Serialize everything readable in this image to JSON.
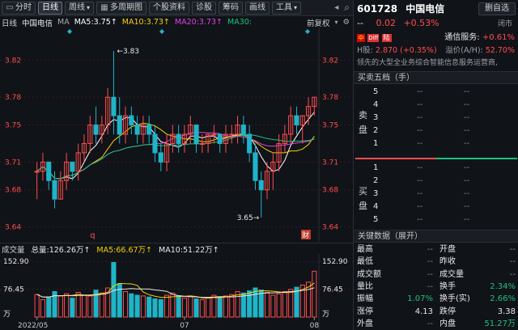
{
  "toolbar": {
    "items": [
      {
        "label": "分时",
        "icon": "timeshare-icon",
        "active": false
      },
      {
        "label": "日线",
        "icon": "",
        "active": true
      },
      {
        "label": "周线",
        "icon": "chevron-down-icon",
        "active": false
      },
      {
        "label": "多周期图",
        "icon": "grid-icon",
        "active": false
      },
      {
        "label": "个股资料",
        "icon": "",
        "active": false
      },
      {
        "label": "诊股",
        "icon": "",
        "active": false
      },
      {
        "label": "筹码",
        "icon": "",
        "active": false
      },
      {
        "label": "画线",
        "icon": "",
        "active": false
      },
      {
        "label": "工具",
        "icon": "chevron-down-icon",
        "active": false
      }
    ],
    "more_glyph": "◂",
    "search_glyph": "⌕"
  },
  "ma_bar": {
    "period": "日线",
    "name": "中国电信",
    "ma_label": "MA",
    "ma5": "MA5:3.75↑",
    "ma10": "MA10:3.73↑",
    "ma20": "MA20:3.73↑",
    "ma30": "MA30:",
    "adjust": "前复权",
    "colors": {
      "ma5": "#ffffff",
      "ma10": "#f5d100",
      "ma20": "#e040e0",
      "ma30": "#19c37d"
    }
  },
  "chart_data": {
    "type": "candlestick",
    "ylim": [
      3.63,
      3.85
    ],
    "ytick_labels": [
      "3.82",
      "3.78",
      "3.75",
      "3.71",
      "3.68",
      "3.64"
    ],
    "ytick_values": [
      3.82,
      3.78,
      3.75,
      3.71,
      3.68,
      3.64
    ],
    "annotations": {
      "high": "3.83",
      "low": "3.65"
    },
    "markers": {
      "q": "q",
      "cai": "财"
    },
    "x_labels": [
      "2022/05",
      "07",
      "08"
    ],
    "x_label_index": [
      0,
      25,
      47
    ],
    "candles": [
      [
        3.7,
        3.71,
        3.67,
        3.7
      ],
      [
        3.7,
        3.72,
        3.69,
        3.71
      ],
      [
        3.71,
        3.71,
        3.68,
        3.69
      ],
      [
        3.69,
        3.7,
        3.66,
        3.67
      ],
      [
        3.67,
        3.7,
        3.67,
        3.69
      ],
      [
        3.69,
        3.72,
        3.68,
        3.71
      ],
      [
        3.71,
        3.71,
        3.69,
        3.7
      ],
      [
        3.7,
        3.73,
        3.69,
        3.72
      ],
      [
        3.72,
        3.74,
        3.71,
        3.73
      ],
      [
        3.73,
        3.76,
        3.72,
        3.75
      ],
      [
        3.75,
        3.77,
        3.73,
        3.74
      ],
      [
        3.74,
        3.76,
        3.73,
        3.75
      ],
      [
        3.75,
        3.79,
        3.74,
        3.78
      ],
      [
        3.78,
        3.83,
        3.74,
        3.76
      ],
      [
        3.76,
        3.78,
        3.73,
        3.74
      ],
      [
        3.74,
        3.77,
        3.73,
        3.76
      ],
      [
        3.76,
        3.77,
        3.74,
        3.75
      ],
      [
        3.75,
        3.76,
        3.73,
        3.74
      ],
      [
        3.74,
        3.76,
        3.73,
        3.75
      ],
      [
        3.75,
        3.76,
        3.73,
        3.74
      ],
      [
        3.74,
        3.75,
        3.71,
        3.72
      ],
      [
        3.72,
        3.73,
        3.7,
        3.71
      ],
      [
        3.71,
        3.74,
        3.7,
        3.73
      ],
      [
        3.73,
        3.75,
        3.72,
        3.74
      ],
      [
        3.74,
        3.75,
        3.72,
        3.73
      ],
      [
        3.73,
        3.75,
        3.72,
        3.74
      ],
      [
        3.74,
        3.76,
        3.73,
        3.75
      ],
      [
        3.75,
        3.75,
        3.72,
        3.73
      ],
      [
        3.73,
        3.74,
        3.72,
        3.73
      ],
      [
        3.73,
        3.74,
        3.72,
        3.74
      ],
      [
        3.74,
        3.75,
        3.73,
        3.74
      ],
      [
        3.74,
        3.74,
        3.72,
        3.73
      ],
      [
        3.73,
        3.75,
        3.72,
        3.74
      ],
      [
        3.74,
        3.75,
        3.73,
        3.74
      ],
      [
        3.74,
        3.76,
        3.73,
        3.75
      ],
      [
        3.75,
        3.76,
        3.73,
        3.74
      ],
      [
        3.74,
        3.75,
        3.71,
        3.72
      ],
      [
        3.72,
        3.73,
        3.68,
        3.69
      ],
      [
        3.69,
        3.7,
        3.65,
        3.68
      ],
      [
        3.68,
        3.71,
        3.67,
        3.7
      ],
      [
        3.7,
        3.72,
        3.68,
        3.71
      ],
      [
        3.71,
        3.74,
        3.7,
        3.73
      ],
      [
        3.73,
        3.75,
        3.72,
        3.74
      ],
      [
        3.74,
        3.77,
        3.73,
        3.76
      ],
      [
        3.76,
        3.77,
        3.74,
        3.75
      ],
      [
        3.75,
        3.76,
        3.73,
        3.76
      ],
      [
        3.76,
        3.78,
        3.75,
        3.77
      ],
      [
        3.77,
        3.78,
        3.76,
        3.78
      ]
    ]
  },
  "volume": {
    "title": "成交量",
    "total": "总量:126.26万↑",
    "ma5": "MA5:66.67万↑",
    "ma10": "MA10:51.22万↑",
    "ylim": [
      0,
      160
    ],
    "tick_labels": [
      "152.90",
      "76.45",
      "万"
    ],
    "tick_values": [
      152.9,
      76.45,
      0
    ],
    "values": [
      62,
      48,
      55,
      70,
      58,
      64,
      52,
      68,
      60,
      58,
      74,
      66,
      80,
      150,
      92,
      70,
      64,
      60,
      58,
      55,
      50,
      48,
      60,
      66,
      58,
      52,
      56,
      50,
      48,
      54,
      60,
      55,
      58,
      62,
      70,
      66,
      72,
      80,
      74,
      68,
      60,
      64,
      70,
      76,
      82,
      88,
      96,
      126
    ]
  },
  "right": {
    "code": "601728",
    "name": "中国电信",
    "buttons": {
      "delete": "删自选"
    },
    "price_line": {
      "price": "--",
      "change": "0.02",
      "pct": "+0.53%",
      "status": "闭市"
    },
    "tags": {
      "flag": "中",
      "diff": "Diff",
      "lu": "陆",
      "tong_label": "通信服务:",
      "tong_val": "+0.61%"
    },
    "h_line": {
      "label": "H股:",
      "val": "2.870 (+0.35%)",
      "prem_label": "溢价(A/H):",
      "prem_val": "52.70%"
    },
    "desc": "领先的大型全业务综合智能信息服务运营商,",
    "order_book": {
      "title": "买卖五档（手）",
      "sell_label": [
        "卖",
        "盘"
      ],
      "buy_label": [
        "买",
        "盘"
      ],
      "sell": [
        {
          "lvl": "5",
          "p": "--",
          "v": "--"
        },
        {
          "lvl": "4",
          "p": "--",
          "v": "--"
        },
        {
          "lvl": "3",
          "p": "--",
          "v": "--"
        },
        {
          "lvl": "2",
          "p": "--",
          "v": "--"
        },
        {
          "lvl": "1",
          "p": "--",
          "v": "--"
        }
      ],
      "buy": [
        {
          "lvl": "1",
          "p": "--",
          "v": "--"
        },
        {
          "lvl": "2",
          "p": "--",
          "v": "--"
        },
        {
          "lvl": "3",
          "p": "--",
          "v": "--"
        },
        {
          "lvl": "4",
          "p": "--",
          "v": "--"
        },
        {
          "lvl": "5",
          "p": "--",
          "v": "--"
        }
      ]
    },
    "key_data": {
      "title": "关键数据（展开）",
      "rows": [
        {
          "l1": "最高",
          "v1": "--",
          "c1": "dash",
          "l2": "开盘",
          "v2": "--",
          "c2": "dash"
        },
        {
          "l1": "最低",
          "v1": "--",
          "c1": "dash",
          "l2": "昨收",
          "v2": "--",
          "c2": "dash"
        },
        {
          "l1": "成交额",
          "v1": "--",
          "c1": "dash",
          "l2": "成交量",
          "v2": "--",
          "c2": "dash"
        },
        {
          "l1": "量比",
          "v1": "--",
          "c1": "dash",
          "l2": "换手",
          "v2": "2.34%",
          "c2": "green"
        },
        {
          "l1": "振幅",
          "v1": "1.07%",
          "c1": "green",
          "l2": "换手(实)",
          "v2": "2.66%",
          "c2": "green"
        },
        {
          "l1": "涨停",
          "v1": "4.13",
          "c1": "white",
          "l2": "跌停",
          "v2": "3.38",
          "c2": "white"
        },
        {
          "l1": "外盘",
          "v1": "--",
          "c1": "dash",
          "l2": "内盘",
          "v2": "51.27万",
          "c2": "green"
        }
      ]
    }
  }
}
